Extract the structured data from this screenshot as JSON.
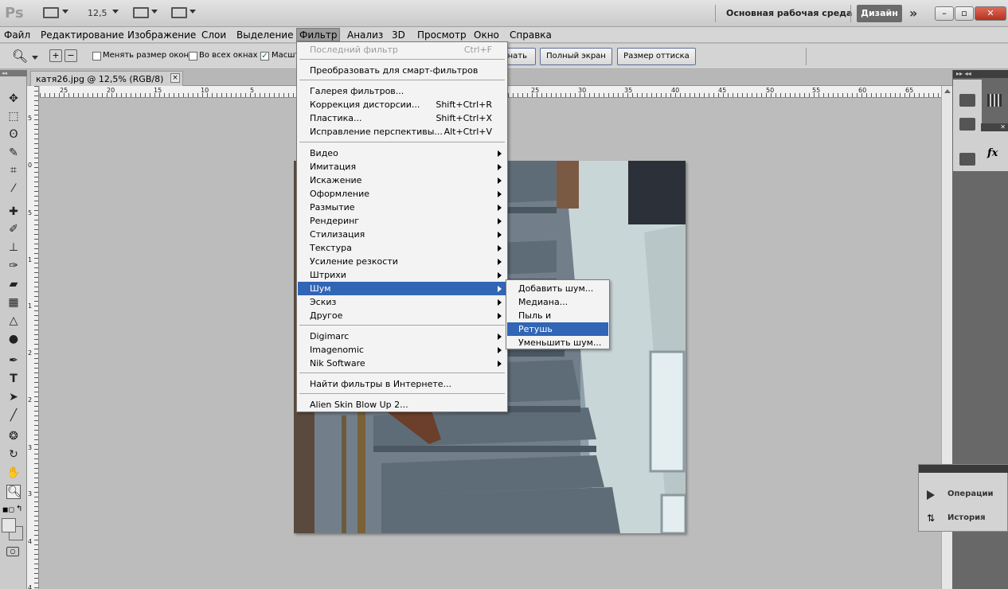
{
  "app": {
    "logo": "Ps",
    "zoom": "12,5"
  },
  "workspace": {
    "label": "Основная рабочая среда",
    "design": "Дизайн",
    "more": "»"
  },
  "window_controls": {
    "minimize": "–",
    "restore": "▫",
    "close": "✕"
  },
  "menubar": [
    "Файл",
    "Редактирование",
    "Изображение",
    "Слои",
    "Выделение",
    "Фильтр",
    "Анализ",
    "3D",
    "Просмотр",
    "Окно",
    "Справка"
  ],
  "options": {
    "resize_windows": "Менять размер окон",
    "all_windows": "Во всех окнах",
    "scale": "Масшт",
    "fit_tail": "нать",
    "full_screen": "Полный экран",
    "print_size": "Размер оттиска"
  },
  "document": {
    "tab_title": "катя26.jpg @ 12,5% (RGB/8)",
    "tab_close": "×"
  },
  "ruler": {
    "h_left": [
      "25",
      "20",
      "15",
      "10",
      "5",
      "0"
    ],
    "h_right": [
      "25",
      "30",
      "35",
      "40",
      "45",
      "50",
      "55",
      "60",
      "65"
    ],
    "v": [
      "5",
      "0",
      "5",
      "1",
      "1",
      "2",
      "2",
      "3",
      "3",
      "4",
      "4"
    ]
  },
  "filter_menu": {
    "last_filter": {
      "label": "Последний фильтр",
      "shortcut": "Ctrl+F"
    },
    "smart": "Преобразовать для смарт-фильтров",
    "group1": [
      {
        "label": "Галерея фильтров...",
        "shortcut": ""
      },
      {
        "label": "Коррекция дисторсии...",
        "shortcut": "Shift+Ctrl+R"
      },
      {
        "label": "Пластика...",
        "shortcut": "Shift+Ctrl+X"
      },
      {
        "label": "Исправление перспективы...",
        "shortcut": "Alt+Ctrl+V"
      }
    ],
    "group2": [
      "Видео",
      "Имитация",
      "Искажение",
      "Оформление",
      "Размытие",
      "Рендеринг",
      "Стилизация",
      "Текстура",
      "Усиление резкости",
      "Штрихи",
      "Шум",
      "Эскиз",
      "Другое"
    ],
    "group3": [
      "Digimarc",
      "Imagenomic",
      "Nik Software"
    ],
    "online": "Найти фильтры в Интернете...",
    "plugin": "Alien Skin Blow Up 2..."
  },
  "noise_submenu": [
    "Добавить шум...",
    "Медиана...",
    "Пыль и царапины...",
    "Ретушь",
    "Уменьшить шум..."
  ],
  "panels": {
    "actions": "Операции",
    "history": "История",
    "fx": "fx"
  },
  "colors": {
    "accent": "#3165b5",
    "design_btn": "#6b6b6b"
  }
}
